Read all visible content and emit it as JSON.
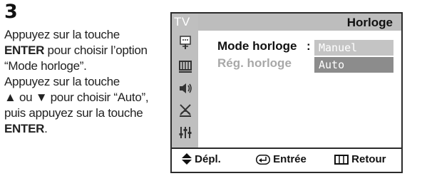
{
  "step": {
    "number": "3"
  },
  "instructions": {
    "line1": "Appuyez sur la touche",
    "enter1": "ENTER",
    "line2_rest": " pour choisir l’option",
    "line3": "“Mode horloge”.",
    "line4": "Appuyez sur la touche",
    "line5_up": "▲",
    "line5_mid": " ou ",
    "line5_down": "▼",
    "line5_rest": " pour choisir “Auto”,",
    "line6": "puis appuyez sur la touche",
    "enter2": "ENTER",
    "line7_rest": "."
  },
  "osd": {
    "sidebar_label": "TV",
    "header_title": "Horloge",
    "rows": [
      {
        "label": "Mode horloge",
        "colon": ":",
        "option": "Manuel"
      },
      {
        "label": "Rég. horloge",
        "option": "Auto"
      }
    ],
    "footer": {
      "move": "Dépl.",
      "enter": "Entrée",
      "return": "Retour"
    },
    "sidebar_icons": [
      "picture-icon",
      "channel-icon",
      "sound-icon",
      "antenna-icon",
      "setup-icon"
    ],
    "colors": {
      "frame": "#2b2b2b",
      "header_bg": "#bdbdbd",
      "selected_option": "#8c8c8c",
      "option": "#c4c4c4",
      "dim_text": "#a8a8a8"
    }
  }
}
